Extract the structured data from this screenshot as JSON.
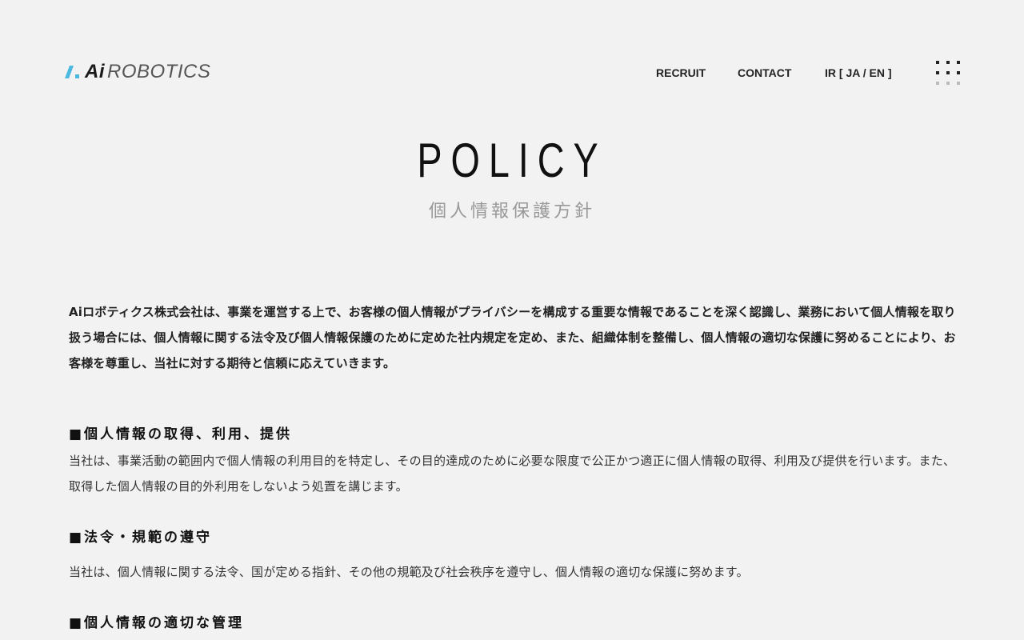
{
  "header": {
    "logo_ai": "Ai",
    "logo_robotics": "ROBOTICS",
    "nav": {
      "recruit": "RECRUIT",
      "contact": "CONTACT",
      "ir": "IR [ JA / EN ]"
    },
    "menu_icon": "grid-dots-icon"
  },
  "hero": {
    "title": "POLICY",
    "subtitle": "個人情報保護方針"
  },
  "intro": "Aiロボティクス株式会社は、事業を運営する上で、お客様の個人情報がプライバシーを構成する重要な情報であることを深く認識し、業務において個人情報を取り扱う場合には、個人情報に関する法令及び個人情報保護のために定めた社内規定を定め、また、組織体制を整備し、個人情報の適切な保護に努めることにより、お客様を尊重し、当社に対する期待と信頼に応えていきます。",
  "sections": [
    {
      "heading": "■個人情報の取得、利用、提供",
      "text": "当社は、事業活動の範囲内で個人情報の利用目的を特定し、その目的達成のために必要な限度で公正かつ適正に個人情報の取得、利用及び提供を行います。また、取得した個人情報の目的外利用をしないよう処置を講じます。"
    },
    {
      "heading": "■法令・規範の遵守",
      "text": "当社は、個人情報に関する法令、国が定める指針、その他の規範及び社会秩序を遵守し、個人情報の適切な保護に努めます。"
    },
    {
      "heading": "■個人情報の適切な管理"
    }
  ],
  "colors": {
    "background": "#f2f2f2",
    "logo_accent": "#4bb8e0",
    "text": "#222222",
    "subtitle": "#999999"
  }
}
